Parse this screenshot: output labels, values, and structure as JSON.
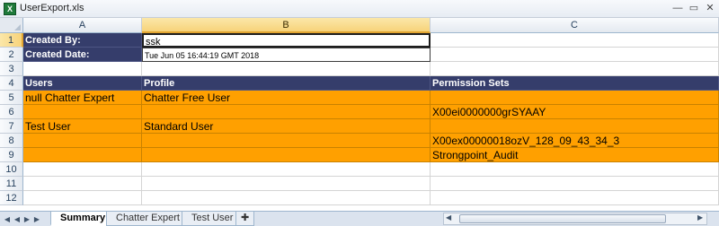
{
  "window": {
    "title": "UserExport.xls",
    "controls": [
      "—",
      "▭",
      "✕"
    ]
  },
  "columns": [
    "A",
    "B",
    "C"
  ],
  "rows": [
    "1",
    "2",
    "3",
    "4",
    "5",
    "6",
    "7",
    "8",
    "9",
    "10",
    "11",
    "12"
  ],
  "cells": {
    "r1": {
      "a": "Created By:",
      "b": "ssk"
    },
    "r2": {
      "a": "Created Date:",
      "b": "Tue Jun 05 16:44:19 GMT 2018"
    },
    "r4": {
      "a": "Users",
      "b": "Profile",
      "c": "Permission Sets"
    },
    "r5": {
      "a": "null Chatter Expert",
      "b": "Chatter Free User",
      "c": ""
    },
    "r6": {
      "a": "",
      "b": "",
      "c": "X00ei0000000grSYAAY"
    },
    "r7": {
      "a": "Test User",
      "b": "Standard User",
      "c": ""
    },
    "r8": {
      "a": "",
      "b": "",
      "c": "X00ex00000018ozV_128_09_43_34_3"
    },
    "r9": {
      "a": "",
      "b": "",
      "c": "Strongpoint_Audit"
    }
  },
  "sheets": [
    "Summary",
    "Chatter Expert",
    "Test User"
  ],
  "active_sheet": "Summary",
  "colors": {
    "header_fill": "#353d6b",
    "data_fill": "#ffa000",
    "selection": "#f7d37a"
  },
  "icons": [
    "excel-file-icon",
    "first-sheet-icon",
    "prev-sheet-icon",
    "next-sheet-icon",
    "last-sheet-icon",
    "new-sheet-icon"
  ]
}
